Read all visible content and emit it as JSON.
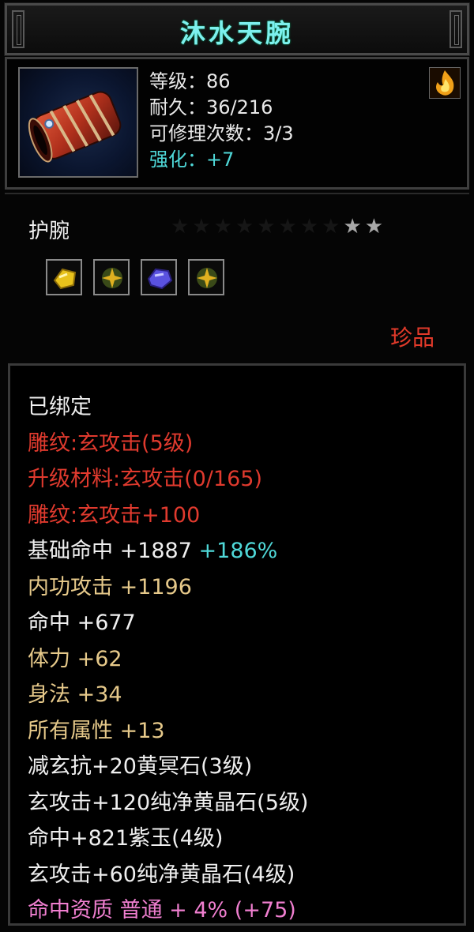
{
  "item": {
    "name": "沐水天腕",
    "icon": "bracer-item-icon",
    "stats": {
      "level": "等级：86",
      "durability": "耐久：36/216",
      "repairs": "可修理次数：3/3",
      "enhance": "强化：+7"
    },
    "element_icon": "fire-icon"
  },
  "type_section": {
    "type_name": "护腕",
    "stars_total": 10,
    "stars_lit": 2,
    "stars_text": "★★★★★★★★★★",
    "gems": [
      {
        "icon": "yellow-gem-icon",
        "color": "#e8c21c"
      },
      {
        "icon": "green-gold-gem-icon",
        "color": "#c9a21a"
      },
      {
        "icon": "purple-jade-icon",
        "color": "#5a52e0"
      },
      {
        "icon": "green-gold-gem-icon",
        "color": "#c9a21a"
      }
    ],
    "rarity": "珍品"
  },
  "attributes": [
    {
      "text": "已绑定",
      "color": "white"
    },
    {
      "text": "雕纹:玄攻击(5级)",
      "color": "red"
    },
    {
      "text": "升级材料:玄攻击(0/165)",
      "color": "red"
    },
    {
      "text": "雕纹:玄攻击+100",
      "color": "red"
    },
    {
      "text": "基础命中 +1887",
      "extra": "+186%",
      "color": "white"
    },
    {
      "text": "内功攻击 +1196",
      "color": "tan"
    },
    {
      "text": "命中 +677",
      "color": "white"
    },
    {
      "text": "体力 +62",
      "color": "tan"
    },
    {
      "text": "身法 +34",
      "color": "tan"
    },
    {
      "text": "所有属性 +13",
      "color": "tan"
    },
    {
      "text": "减玄抗+20黄冥石(3级)",
      "color": "white"
    },
    {
      "text": "玄攻击+120纯净黄晶石(5级)",
      "color": "white"
    },
    {
      "text": "命中+821紫玉(4级)",
      "color": "white"
    },
    {
      "text": "玄攻击+60纯净黄晶石(4级)",
      "color": "white"
    },
    {
      "text": "命中资质 普通 + 4% (+75)",
      "color": "pink"
    }
  ],
  "colors": {
    "title": "#7df0ee",
    "white": "#efefef",
    "red": "#e03a2e",
    "tan": "#e6c98a",
    "pink": "#f07fd0",
    "cyan": "#4fd8d8"
  }
}
